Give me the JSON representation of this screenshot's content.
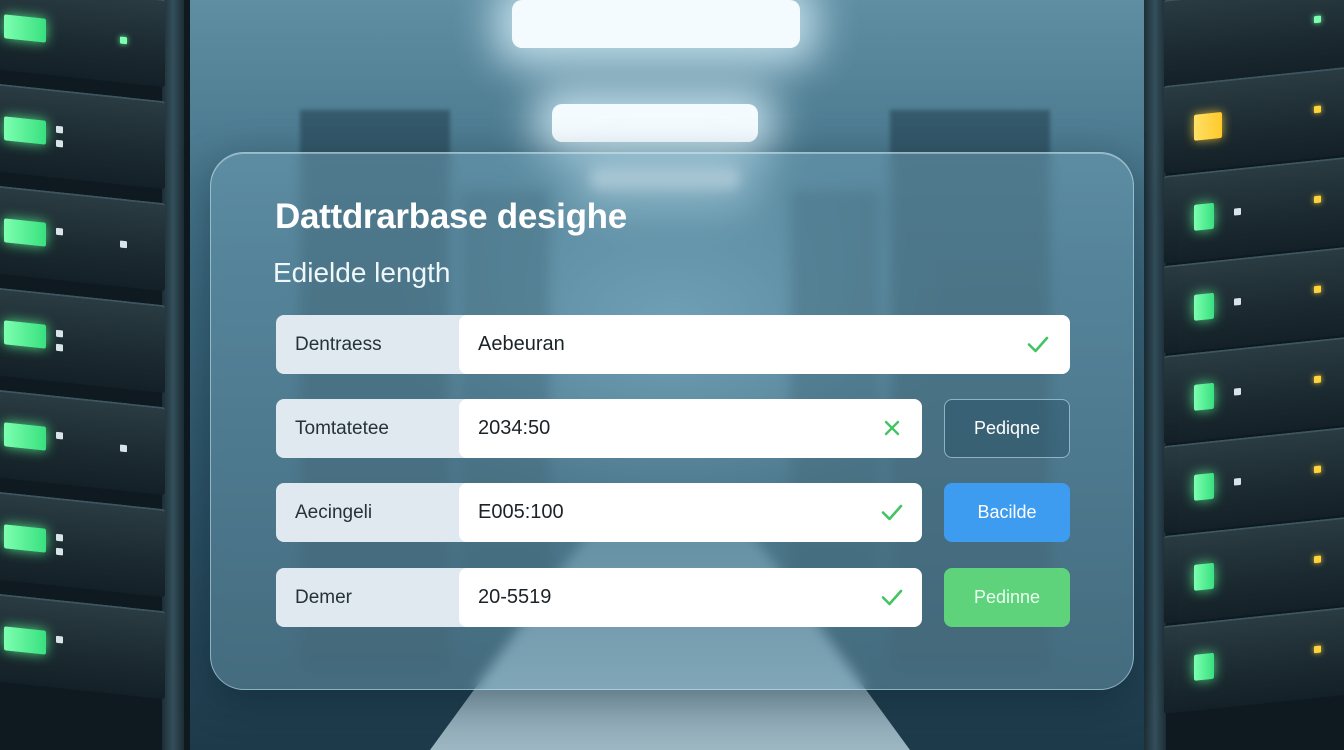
{
  "panel": {
    "title": "Dattdrarbase desighe",
    "subtitle": "Edielde length"
  },
  "fields": [
    {
      "label": "Dentraess",
      "value": "Aebeuran",
      "status": "check",
      "button": null
    },
    {
      "label": "Tomtatetee",
      "value": "2034:50",
      "status": "cross",
      "button": {
        "label": "Pediqne",
        "style": "outline"
      }
    },
    {
      "label": "Aecingeli",
      "value": "E005:100",
      "status": "check",
      "button": {
        "label": "Bacilde",
        "style": "blue"
      }
    },
    {
      "label": "Demer",
      "value": "20-5519",
      "status": "check",
      "button": {
        "label": "Pedinne",
        "style": "green"
      }
    }
  ],
  "colors": {
    "check": "#43c463",
    "cross": "#43c463",
    "button_blue": "#3d9cf0",
    "button_green": "#5fd37c"
  }
}
